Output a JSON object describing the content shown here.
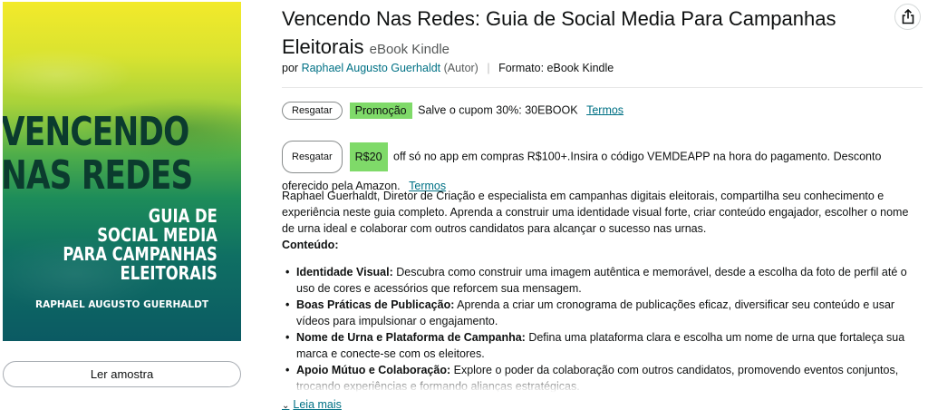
{
  "cover": {
    "title_line1": "VENCENDO",
    "title_line2": "NAS REDES",
    "subtitle_lines": [
      "GUIA DE",
      "SOCIAL MEDIA",
      "PARA CAMPANHAS",
      "ELEITORAIS"
    ],
    "author": "RAPHAEL AUGUSTO GUERHALDT"
  },
  "sample_button": "Ler amostra",
  "product": {
    "title": "Vencendo Nas Redes: Guia de Social Media Para Campanhas Eleitorais",
    "format_inline": "eBook Kindle",
    "by": "por",
    "author": "Raphael Augusto Guerhaldt",
    "author_role": "(Autor)",
    "format_label": "Formato: eBook Kindle"
  },
  "coupons": [
    {
      "button": "Resgatar",
      "badge": "Promoção",
      "text": "Salve o cupom 30%: 30EBOOK",
      "link": "Termos"
    },
    {
      "button": "Resgatar",
      "badge": "R$20",
      "text_line1": "off só no app em compras R$100+.Insira o código VEMDEAPP na hora do pagamento. Desconto",
      "text_line2": "oferecido pela Amazon.",
      "link": "Termos"
    }
  ],
  "description": {
    "paragraph": "Raphael Guerhaldt, Diretor de Criação e especialista em campanhas digitais eleitorais, compartilha seu conhecimento e experiência neste guia completo. Aprenda a construir uma identidade visual forte, criar conteúdo engajador, escolher o nome de urna ideal e colaborar com outros candidatos para alcançar o sucesso nas urnas.",
    "heading": "Conteúdo:",
    "bullets": [
      {
        "term": "Identidade Visual:",
        "text": " Descubra como construir uma imagem autêntica e memorável, desde a escolha da foto de perfil até o uso de cores e acessórios que reforcem sua mensagem."
      },
      {
        "term": "Boas Práticas de Publicação:",
        "text": " Aprenda a criar um cronograma de publicações eficaz, diversificar seu conteúdo e usar vídeos para impulsionar o engajamento."
      },
      {
        "term": "Nome de Urna e Plataforma de Campanha:",
        "text": " Defina uma plataforma clara e escolha um nome de urna que fortaleça sua marca e conecte-se com os eleitores."
      },
      {
        "term": "Apoio Mútuo e Colaboração:",
        "text": " Explore o poder da colaboração com outros candidatos, promovendo eventos conjuntos, trocando experiências e formando alianças estratégicas."
      }
    ],
    "read_more": "Leia mais"
  },
  "icons": {
    "share": "share-icon",
    "read_more_chevron": "chevron-down-icon"
  }
}
